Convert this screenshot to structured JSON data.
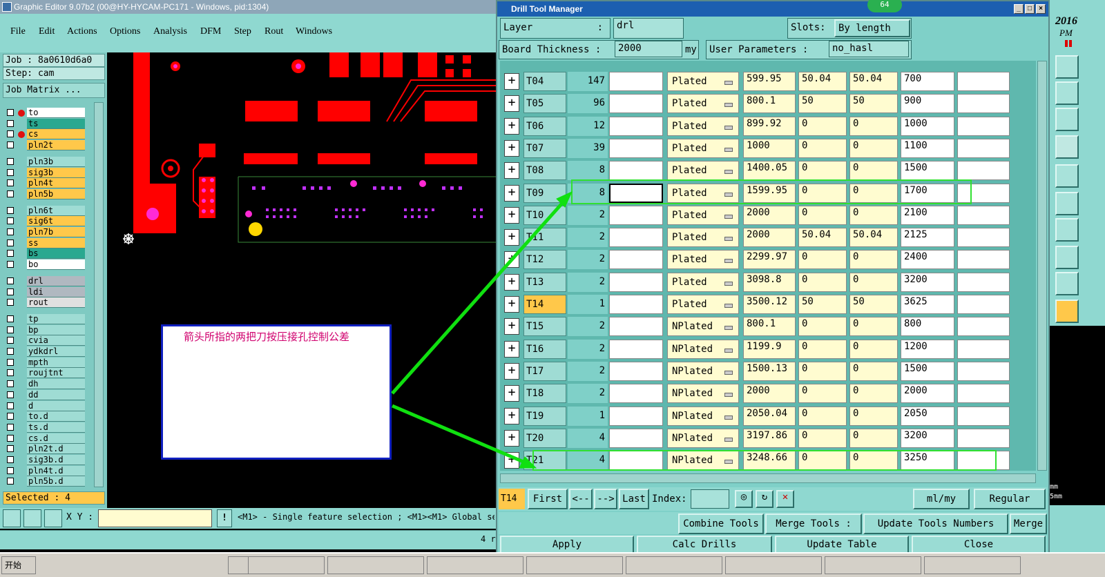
{
  "main": {
    "title": "Graphic Editor 9.07b2 (00@HY-HYCAM-PC171 - Windows, pid:1304)",
    "menu": [
      "File",
      "Edit",
      "Actions",
      "Options",
      "Analysis",
      "DFM",
      "Step",
      "Rout",
      "Windows"
    ],
    "job": "Job : 8a0610d6a0",
    "step": "Step: cam",
    "job_matrix": "Job Matrix ...",
    "layers": [
      {
        "name": "to",
        "color": "#ffffff",
        "mark": "red"
      },
      {
        "name": "ts",
        "color": "#2aa890"
      },
      {
        "name": "cs",
        "color": "#ffc84a",
        "mark": "red"
      },
      {
        "name": "pln2t",
        "color": "#ffc84a"
      },
      {
        "name": "pln3b",
        "color": "#9fdcd4"
      },
      {
        "name": "sig3b",
        "color": "#ffc84a"
      },
      {
        "name": "pln4t",
        "color": "#ffc84a"
      },
      {
        "name": "pln5b",
        "color": "#ffc84a"
      },
      {
        "name": "pln6t",
        "color": "#9fdcd4"
      },
      {
        "name": "sig6t",
        "color": "#ffc84a"
      },
      {
        "name": "pln7b",
        "color": "#ffc84a"
      },
      {
        "name": "ss",
        "color": "#ffc84a"
      },
      {
        "name": "bs",
        "color": "#2aa890"
      },
      {
        "name": "bo",
        "color": "#ffffff"
      },
      {
        "name": "drl",
        "color": "#b0b8c0"
      },
      {
        "name": "ldi",
        "color": "#b0b8c0"
      },
      {
        "name": "rout",
        "color": "#e0e0e0"
      },
      {
        "name": "tp",
        "color": "#9fdcd4"
      },
      {
        "name": "bp",
        "color": "#9fdcd4"
      },
      {
        "name": "cvia",
        "color": "#9fdcd4"
      },
      {
        "name": "ydkdrl",
        "color": "#9fdcd4"
      },
      {
        "name": "mpth",
        "color": "#9fdcd4"
      },
      {
        "name": "roujtnt",
        "color": "#9fdcd4"
      },
      {
        "name": "dh",
        "color": "#9fdcd4"
      },
      {
        "name": "dd",
        "color": "#9fdcd4"
      },
      {
        "name": "d",
        "color": "#9fdcd4"
      },
      {
        "name": "to.d",
        "color": "#9fdcd4"
      },
      {
        "name": "ts.d",
        "color": "#9fdcd4"
      },
      {
        "name": "cs.d",
        "color": "#9fdcd4"
      },
      {
        "name": "pln2t.d",
        "color": "#9fdcd4"
      },
      {
        "name": "sig3b.d",
        "color": "#9fdcd4"
      },
      {
        "name": "pln4t.d",
        "color": "#9fdcd4"
      },
      {
        "name": "pln5b.d",
        "color": "#9fdcd4"
      }
    ],
    "selected": "Selected : 4",
    "xy_label": "X Y :",
    "status": "<M1> - Single feature selection ; <M1><M1> Global sele",
    "annotation": "箭头所指的两把刀按压接孔控制公差",
    "right_marker": "4 r"
  },
  "dialog": {
    "title": "Drill Tool Manager",
    "badge": "64",
    "layer_label": "Layer",
    "layer_colon": ":",
    "layer_value": "drl",
    "slots_label": "Slots:",
    "slots_value": "By length",
    "board_thickness_label": "Board Thickness :",
    "board_thickness_value": "2000",
    "board_thickness_unit": "my",
    "user_params_label": "User Parameters :",
    "user_params_value": "no_hasl",
    "rows": [
      {
        "tool": "T04",
        "count": "147",
        "type": "Plated",
        "v1": "599.95",
        "v2": "50.04",
        "v3": "50.04",
        "v4": "700"
      },
      {
        "tool": "T05",
        "count": "96",
        "type": "Plated",
        "v1": "800.1",
        "v2": "50",
        "v3": "50",
        "v4": "900"
      },
      {
        "tool": "T06",
        "count": "12",
        "type": "Plated",
        "v1": "899.92",
        "v2": "0",
        "v3": "0",
        "v4": "1000"
      },
      {
        "tool": "T07",
        "count": "39",
        "type": "Plated",
        "v1": "1000",
        "v2": "0",
        "v3": "0",
        "v4": "1100"
      },
      {
        "tool": "T08",
        "count": "8",
        "type": "Plated",
        "v1": "1400.05",
        "v2": "0",
        "v3": "0",
        "v4": "1500"
      },
      {
        "tool": "T09",
        "count": "8",
        "type": "Plated",
        "v1": "1599.95",
        "v2": "0",
        "v3": "0",
        "v4": "1700"
      },
      {
        "tool": "T10",
        "count": "2",
        "type": "Plated",
        "v1": "2000",
        "v2": "0",
        "v3": "0",
        "v4": "2100"
      },
      {
        "tool": "T11",
        "count": "2",
        "type": "Plated",
        "v1": "2000",
        "v2": "50.04",
        "v3": "50.04",
        "v4": "2125"
      },
      {
        "tool": "T12",
        "count": "2",
        "type": "Plated",
        "v1": "2299.97",
        "v2": "0",
        "v3": "0",
        "v4": "2400"
      },
      {
        "tool": "T13",
        "count": "2",
        "type": "Plated",
        "v1": "3098.8",
        "v2": "0",
        "v3": "0",
        "v4": "3200"
      },
      {
        "tool": "T14",
        "count": "1",
        "type": "Plated",
        "v1": "3500.12",
        "v2": "50",
        "v3": "50",
        "v4": "3625"
      },
      {
        "tool": "T15",
        "count": "2",
        "type": "NPlated",
        "v1": "800.1",
        "v2": "0",
        "v3": "0",
        "v4": "800"
      },
      {
        "tool": "T16",
        "count": "2",
        "type": "NPlated",
        "v1": "1199.9",
        "v2": "0",
        "v3": "0",
        "v4": "1200"
      },
      {
        "tool": "T17",
        "count": "2",
        "type": "NPlated",
        "v1": "1500.13",
        "v2": "0",
        "v3": "0",
        "v4": "1500"
      },
      {
        "tool": "T18",
        "count": "2",
        "type": "NPlated",
        "v1": "2000",
        "v2": "0",
        "v3": "0",
        "v4": "2000"
      },
      {
        "tool": "T19",
        "count": "1",
        "type": "NPlated",
        "v1": "2050.04",
        "v2": "0",
        "v3": "0",
        "v4": "2050"
      },
      {
        "tool": "T20",
        "count": "4",
        "type": "NPlated",
        "v1": "3197.86",
        "v2": "0",
        "v3": "0",
        "v4": "3200"
      },
      {
        "tool": "T21",
        "count": "4",
        "type": "NPlated",
        "v1": "3248.66",
        "v2": "0",
        "v3": "0",
        "v4": "3250"
      }
    ],
    "current_tool": "T14",
    "nav": {
      "first": "First",
      "prev": "<--",
      "next": "-->",
      "last": "Last",
      "index": "Index:"
    },
    "units": "ml/my",
    "mode": "Regular",
    "combine": "Combine Tools",
    "merge_tools": "Merge Tools :",
    "update_numbers": "Update Tools Numbers",
    "merge": "Merge",
    "apply": "Apply",
    "calc": "Calc Drills",
    "update_table": "Update Table",
    "close": "Close"
  },
  "clock": {
    "year": "2016",
    "ampm": "PM"
  },
  "right_small": [
    "mm",
    "5mm"
  ],
  "taskbar": [
    "开始",
    "",
    "",
    "",
    "",
    ""
  ]
}
